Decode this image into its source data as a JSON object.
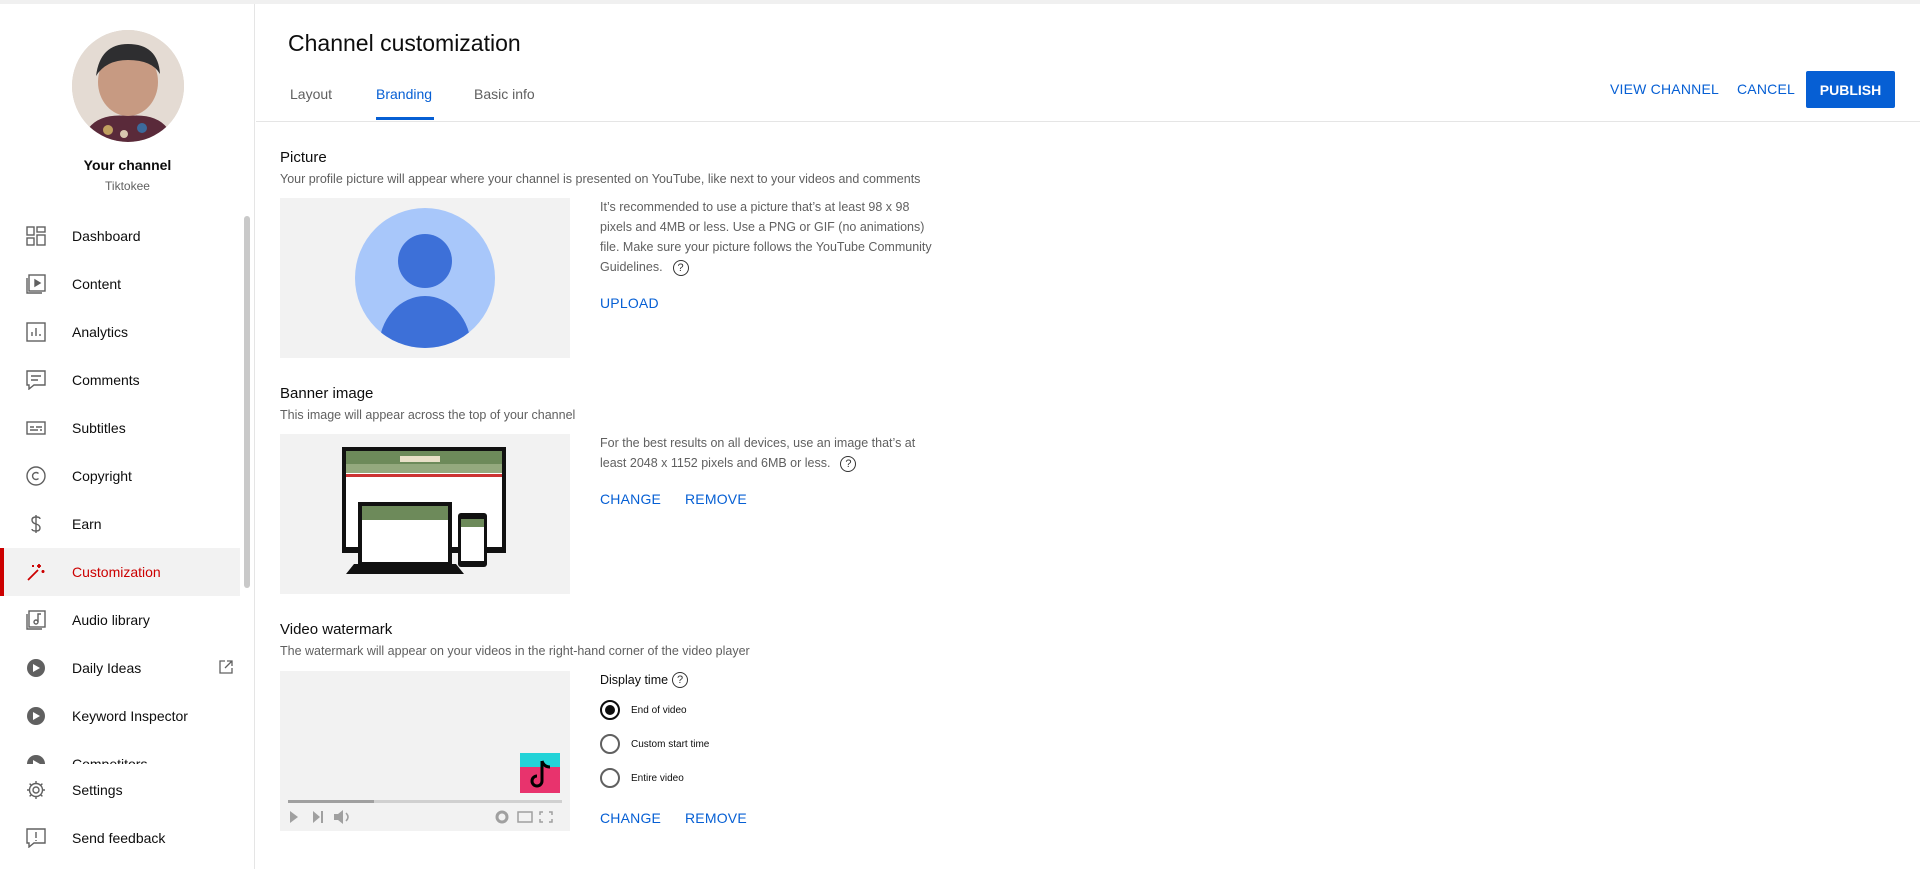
{
  "colors": {
    "accent": "#065fd4",
    "active_nav": "#cc0000"
  },
  "sidebar": {
    "channel_title": "Your channel",
    "channel_handle": "Tiktokee",
    "items": [
      {
        "label": "Dashboard",
        "icon": "dashboard-icon"
      },
      {
        "label": "Content",
        "icon": "content-icon"
      },
      {
        "label": "Analytics",
        "icon": "analytics-icon"
      },
      {
        "label": "Comments",
        "icon": "comments-icon"
      },
      {
        "label": "Subtitles",
        "icon": "subtitles-icon"
      },
      {
        "label": "Copyright",
        "icon": "copyright-icon"
      },
      {
        "label": "Earn",
        "icon": "earn-icon"
      },
      {
        "label": "Customization",
        "icon": "magic-wand-icon"
      },
      {
        "label": "Audio library",
        "icon": "audio-library-icon"
      },
      {
        "label": "Daily Ideas",
        "icon": "extension-icon"
      },
      {
        "label": "Keyword Inspector",
        "icon": "extension-icon"
      },
      {
        "label": "Competitors",
        "icon": "extension-icon"
      },
      {
        "label": "Settings",
        "icon": "gear-icon"
      },
      {
        "label": "Send feedback",
        "icon": "feedback-icon"
      }
    ]
  },
  "header": {
    "title": "Channel customization",
    "tabs": [
      {
        "label": "Layout"
      },
      {
        "label": "Branding"
      },
      {
        "label": "Basic info"
      }
    ],
    "view_channel_label": "VIEW CHANNEL",
    "cancel_label": "CANCEL",
    "publish_label": "PUBLISH"
  },
  "picture": {
    "title": "Picture",
    "description": "Your profile picture will appear where your channel is presented on YouTube, like next to your videos and comments",
    "info": "It’s recommended to use a picture that’s at least 98 x 98 pixels and 4MB or less. Use a PNG or GIF (no animations) file. Make sure your picture follows the YouTube Community Guidelines.",
    "upload_label": "UPLOAD"
  },
  "banner": {
    "title": "Banner image",
    "description": "This image will appear across the top of your channel",
    "info": "For the best results on all devices, use an image that’s at least 2048 x 1152 pixels and 6MB or less.",
    "change_label": "CHANGE",
    "remove_label": "REMOVE"
  },
  "watermark": {
    "title": "Video watermark",
    "description": "The watermark will appear on your videos in the right-hand corner of the video player",
    "display_time_label": "Display time",
    "options": [
      {
        "label": "End of video",
        "selected": true
      },
      {
        "label": "Custom start time",
        "selected": false
      },
      {
        "label": "Entire video",
        "selected": false
      }
    ],
    "change_label": "CHANGE",
    "remove_label": "REMOVE"
  },
  "help_glyph": "?"
}
